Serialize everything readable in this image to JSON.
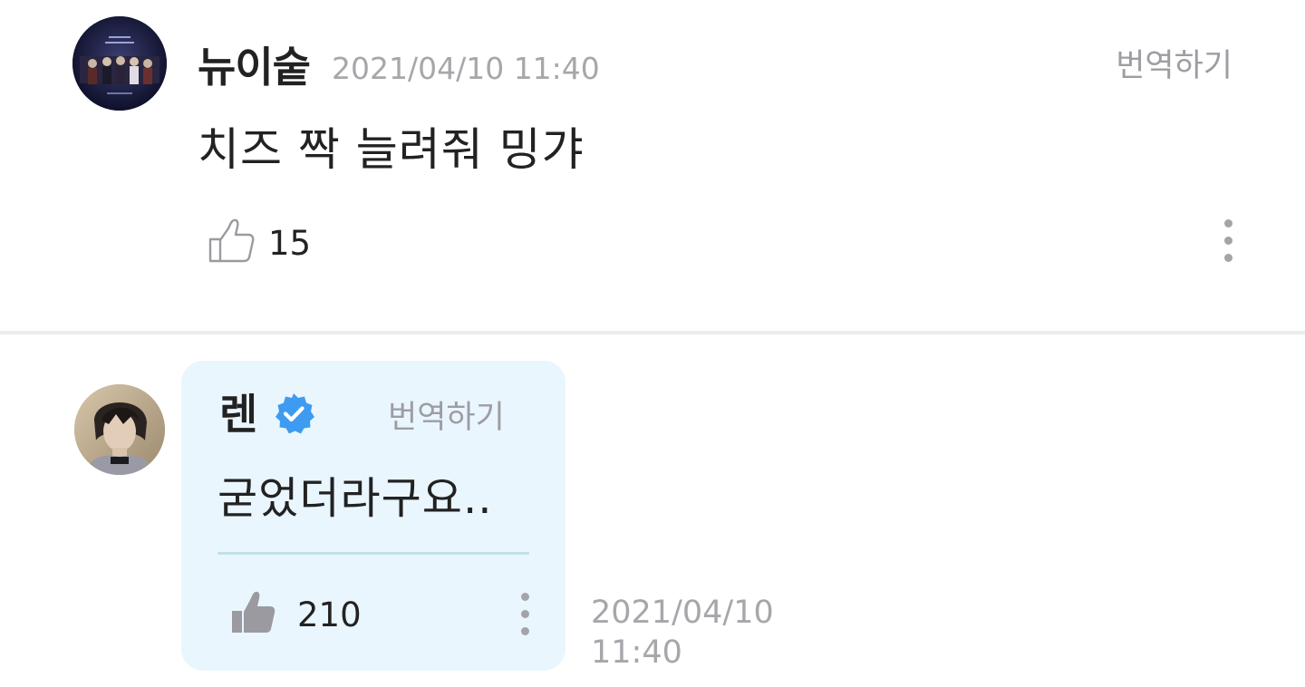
{
  "comments": [
    {
      "author": "뉴이숱",
      "date": "2021/04/10 11:40",
      "translate_label": "번역하기",
      "body": "치즈 짝 늘려줘 밍갸",
      "likes": "15",
      "avatar_icon": "album-cover-avatar"
    }
  ],
  "reply": {
    "author": "렌",
    "verified": true,
    "translate_label": "번역하기",
    "body": "굳었더라구요..",
    "likes": "210",
    "date_line1": "2021/04/10",
    "date_line2": "11:40",
    "avatar_icon": "artist-avatar",
    "bubble_color": "#eaf6fd",
    "verified_color": "#3d9cf1"
  }
}
